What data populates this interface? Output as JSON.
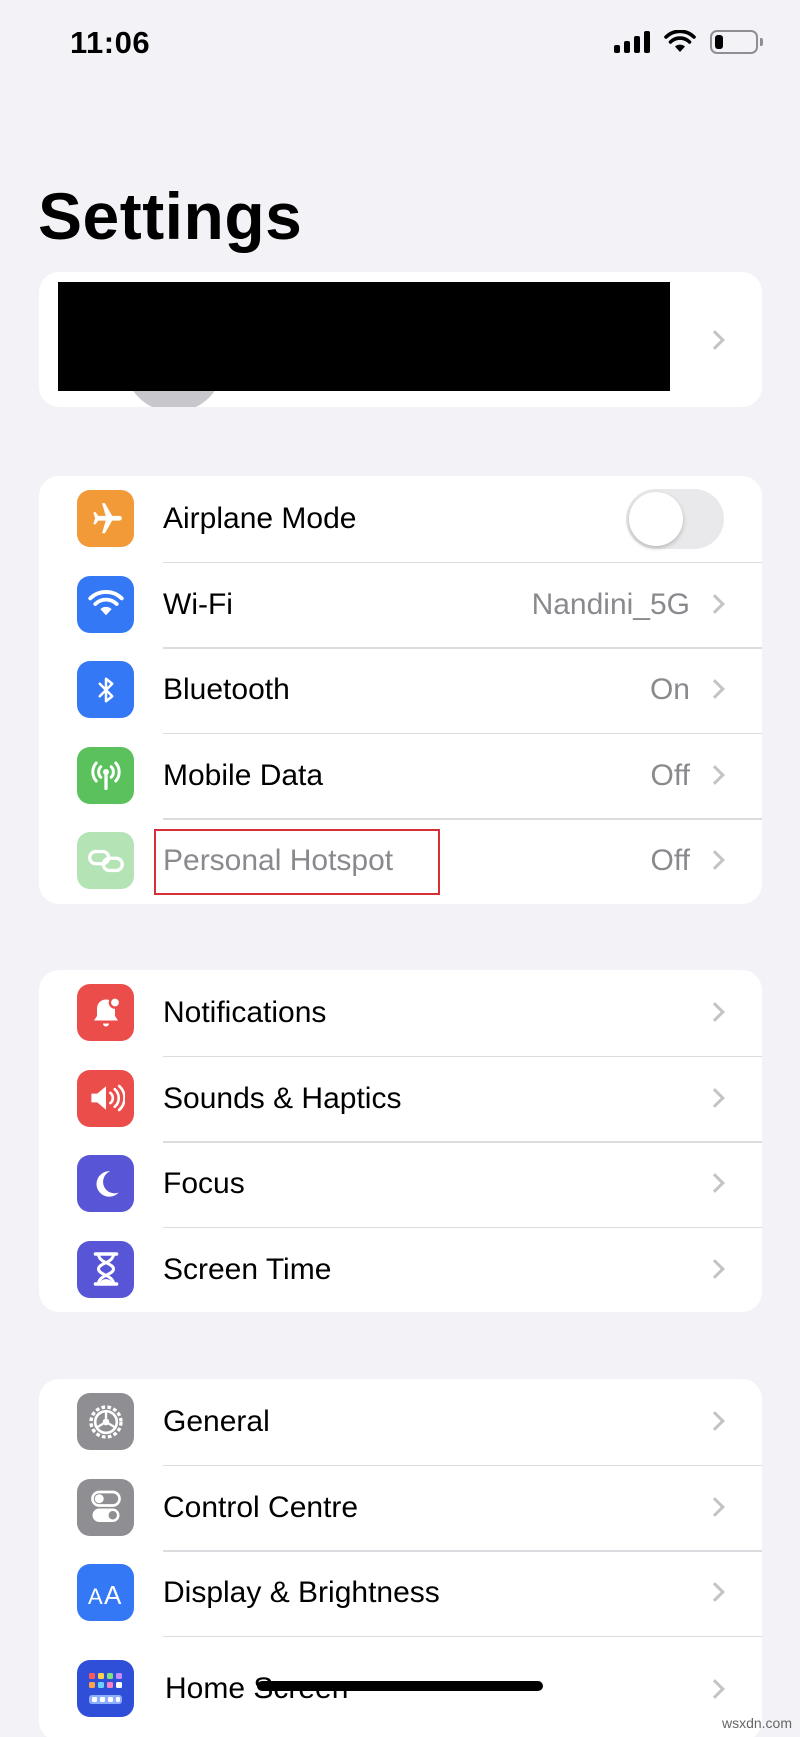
{
  "status_bar": {
    "time": "11:06",
    "battery_level": 0.2
  },
  "page_title": "Settings",
  "groups": [
    {
      "items": [
        {
          "label": "Airplane Mode",
          "icon": "airplane-icon",
          "icon_bg": "#f19a37",
          "control": "toggle",
          "toggle_on": false
        },
        {
          "label": "Wi-Fi",
          "value": "Nandini_5G",
          "icon": "wifi-icon",
          "icon_bg": "#3478f6"
        },
        {
          "label": "Bluetooth",
          "value": "On",
          "icon": "bluetooth-icon",
          "icon_bg": "#3478f6"
        },
        {
          "label": "Mobile Data",
          "value": "Off",
          "icon": "antenna-icon",
          "icon_bg": "#5ac15d"
        },
        {
          "label": "Personal Hotspot",
          "value": "Off",
          "icon": "hotspot-icon",
          "icon_bg": "#5ac15d",
          "disabled": true,
          "highlighted": true
        }
      ]
    },
    {
      "items": [
        {
          "label": "Notifications",
          "icon": "bell-icon",
          "icon_bg": "#eb4d4b"
        },
        {
          "label": "Sounds & Haptics",
          "icon": "speaker-icon",
          "icon_bg": "#eb4d4b"
        },
        {
          "label": "Focus",
          "icon": "moon-icon",
          "icon_bg": "#5856d6"
        },
        {
          "label": "Screen Time",
          "icon": "hourglass-icon",
          "icon_bg": "#5856d6"
        }
      ]
    },
    {
      "items": [
        {
          "label": "General",
          "icon": "gear-icon",
          "icon_bg": "#8e8e93"
        },
        {
          "label": "Control Centre",
          "icon": "switches-icon",
          "icon_bg": "#8e8e93"
        },
        {
          "label": "Display & Brightness",
          "icon": "text-size-icon",
          "icon_bg": "#3478f6"
        },
        {
          "label": "Home Screen",
          "icon": "home-screen-grid-icon",
          "icon_bg": "#2f4fd8"
        }
      ]
    }
  ],
  "watermark": "wsxdn.com",
  "colors": {
    "background": "#f2f2f7",
    "card": "#ffffff",
    "highlight": "#d62f38"
  }
}
